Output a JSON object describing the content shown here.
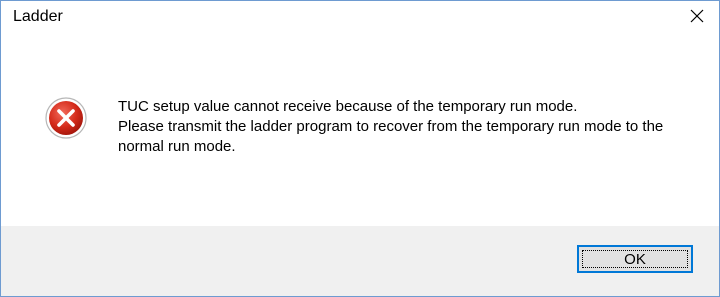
{
  "window": {
    "title": "Ladder",
    "close_glyph": "✕",
    "close_icon": "close-icon"
  },
  "message": {
    "icon": "error-icon",
    "lines": [
      "TUC setup value cannot receive because of the temporary run mode.",
      "Please transmit the ladder program to recover from the temporary run mode to the normal run mode."
    ]
  },
  "buttons": {
    "ok_label": "OK"
  },
  "colors": {
    "accent": "#0078d7",
    "error_red": "#c42b1c",
    "window_border": "#6e9bd1",
    "footer_bg": "#f0f0f0"
  }
}
